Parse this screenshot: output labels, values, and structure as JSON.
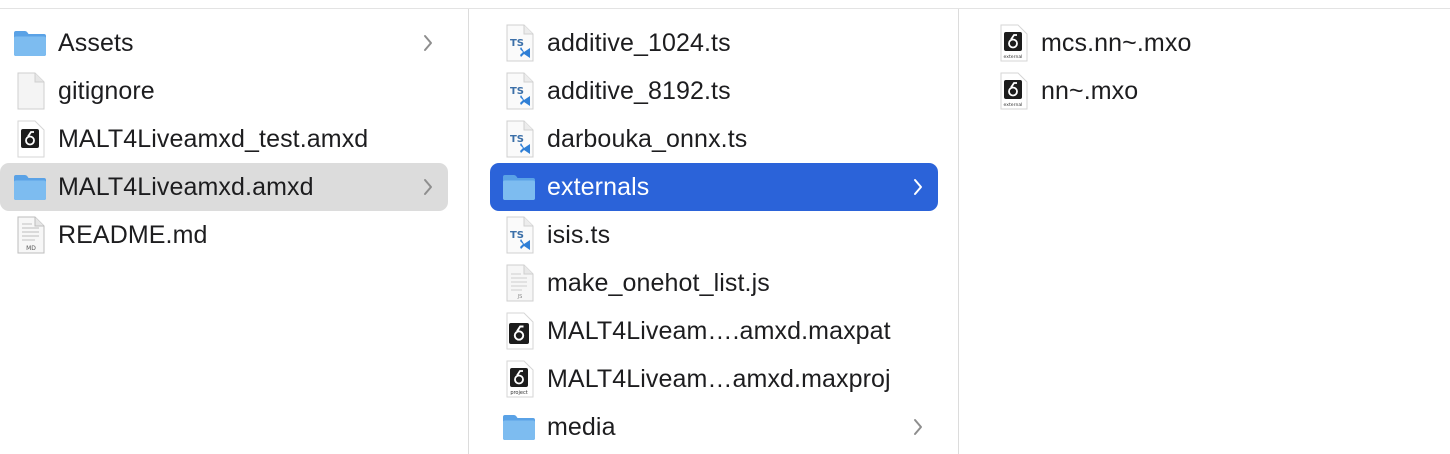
{
  "columns": [
    {
      "items": [
        {
          "name": "Assets",
          "icon": "folder-icon",
          "has_chevron": true,
          "selected": "none"
        },
        {
          "name": "gitignore",
          "icon": "blank-file-icon",
          "has_chevron": false,
          "selected": "none"
        },
        {
          "name": "MALT4Liveamxd_test.amxd",
          "icon": "max-device-icon",
          "has_chevron": false,
          "selected": "none"
        },
        {
          "name": "MALT4Liveamxd.amxd",
          "icon": "folder-icon",
          "has_chevron": true,
          "selected": "inactive"
        },
        {
          "name": "README.md",
          "icon": "markdown-file-icon",
          "has_chevron": false,
          "selected": "none"
        }
      ]
    },
    {
      "items": [
        {
          "name": "additive_1024.ts",
          "icon": "typescript-file-icon",
          "has_chevron": false,
          "selected": "none"
        },
        {
          "name": "additive_8192.ts",
          "icon": "typescript-file-icon",
          "has_chevron": false,
          "selected": "none"
        },
        {
          "name": "darbouka_onnx.ts",
          "icon": "typescript-file-icon",
          "has_chevron": false,
          "selected": "none"
        },
        {
          "name": "externals",
          "icon": "folder-icon",
          "has_chevron": true,
          "selected": "active"
        },
        {
          "name": "isis.ts",
          "icon": "typescript-file-icon",
          "has_chevron": false,
          "selected": "none"
        },
        {
          "name": "make_onehot_list.js",
          "icon": "javascript-file-icon",
          "has_chevron": false,
          "selected": "none"
        },
        {
          "name": "MALT4Liveam….amxd.maxpat",
          "icon": "max-patch-icon",
          "has_chevron": false,
          "selected": "none"
        },
        {
          "name": "MALT4Liveam…amxd.maxproj",
          "icon": "max-project-icon",
          "has_chevron": false,
          "selected": "none"
        },
        {
          "name": "media",
          "icon": "folder-icon",
          "has_chevron": true,
          "selected": "none"
        }
      ]
    },
    {
      "items": [
        {
          "name": "mcs.nn~.mxo",
          "icon": "max-external-icon",
          "has_chevron": false,
          "selected": "none"
        },
        {
          "name": "nn~.mxo",
          "icon": "max-external-icon",
          "has_chevron": false,
          "selected": "none"
        }
      ]
    }
  ],
  "colors": {
    "selection_active": "#2b63d9",
    "selection_inactive": "#dcdcdc",
    "folder": "#74b4ea"
  }
}
